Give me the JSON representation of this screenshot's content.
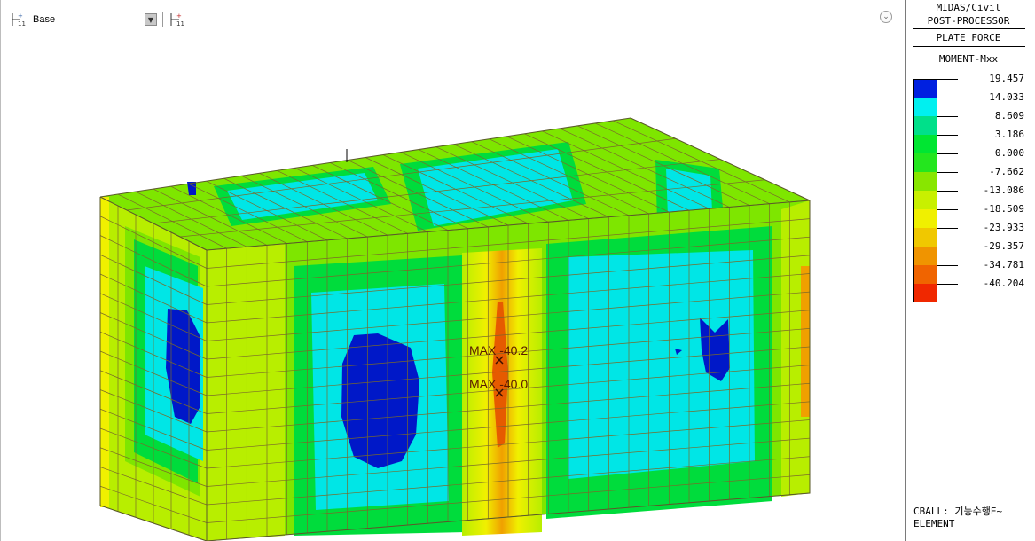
{
  "toolbar": {
    "view_label": "Base",
    "icons": [
      "stage-icon",
      "dropdown-icon",
      "stage-step-icon"
    ]
  },
  "model_view": {
    "max_labels": [
      "MAX -40.2",
      "MAX -40.0"
    ],
    "colors": {
      "dark_blue": "#0018c8",
      "cyan": "#00e6e6",
      "green": "#00dc3c",
      "light_green": "#7ee600",
      "yellow_green": "#b8ee00",
      "yellow": "#f0f000",
      "orange": "#f0a000",
      "red": "#e65a00",
      "mesh": "#7a6a2a"
    }
  },
  "legend": {
    "header_line1": "MIDAS/Civil",
    "header_line2": "POST-PROCESSOR",
    "result_type": "PLATE FORCE",
    "component": "MOMENT-Mxx",
    "values": [
      "19.457",
      "14.033",
      "8.609",
      "3.186",
      "0.000",
      "-7.662",
      "-13.086",
      "-18.509",
      "-23.933",
      "-29.357",
      "-34.781",
      "-40.204"
    ],
    "colors": [
      "#0020e0",
      "#00f0f0",
      "#00e08a",
      "#00e632",
      "#24e61e",
      "#88e600",
      "#c8f000",
      "#f0f000",
      "#f0c800",
      "#f09400",
      "#f06400",
      "#f02800"
    ],
    "footer_line1": "CBALL: 기능수행E~",
    "footer_line2": "ELEMENT"
  }
}
